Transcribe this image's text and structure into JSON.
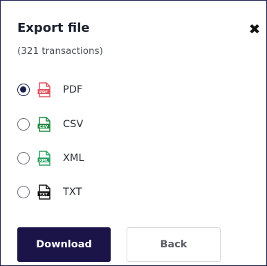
{
  "dialog": {
    "title": "Export file",
    "subtitle": "(321 transactions)",
    "close_icon": "close-icon"
  },
  "formats": [
    {
      "label": "PDF",
      "checked": true,
      "icon": "pdf-file-icon",
      "color": "#e0525e",
      "tag": "PDF"
    },
    {
      "label": "CSV",
      "checked": false,
      "icon": "csv-file-icon",
      "color": "#1e8a3c",
      "tag": "CSV"
    },
    {
      "label": "XML",
      "checked": false,
      "icon": "xml-file-icon",
      "color": "#27a060",
      "tag": "XML"
    },
    {
      "label": "TXT",
      "checked": false,
      "icon": "txt-file-icon",
      "color": "#111111",
      "tag": "TXT"
    }
  ],
  "actions": {
    "download_label": "Download",
    "back_label": "Back"
  },
  "colors": {
    "primary": "#1a1448",
    "border": "#1a1f4d"
  }
}
